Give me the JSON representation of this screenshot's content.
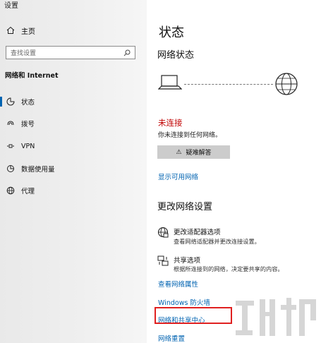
{
  "window": {
    "title": "设置"
  },
  "sidebar": {
    "home_label": "主页",
    "search_placeholder": "查找设置",
    "section_heading": "网络和 Internet",
    "items": [
      {
        "label": "状态",
        "icon": "status-icon",
        "selected": true
      },
      {
        "label": "拨号",
        "icon": "dialup-icon"
      },
      {
        "label": "VPN",
        "icon": "vpn-icon"
      },
      {
        "label": "数据使用量",
        "icon": "data-usage-icon"
      },
      {
        "label": "代理",
        "icon": "globe-icon"
      }
    ]
  },
  "main": {
    "title": "状态",
    "network_status_heading": "网络状态",
    "status_text": "未连接",
    "status_detail": "你未连接到任何网络。",
    "troubleshoot_label": "疑难解答",
    "show_networks_link": "显示可用网络",
    "change_settings_heading": "更改网络设置",
    "options": [
      {
        "title": "更改适配器选项",
        "desc": "查看网络适配器并更改连接设置。",
        "icon": "adapter-icon"
      },
      {
        "title": "共享选项",
        "desc": "根据所连接到的网络，决定要共享的内容。",
        "icon": "sharing-icon"
      }
    ],
    "links": {
      "network_properties": "查看网络属性",
      "firewall": "Windows 防火墙",
      "sharing_center": "网络和共享中心",
      "reset": "网络重置"
    }
  },
  "colors": {
    "accent": "#0063b1",
    "error": "#c00000",
    "highlight": "#e02020"
  }
}
